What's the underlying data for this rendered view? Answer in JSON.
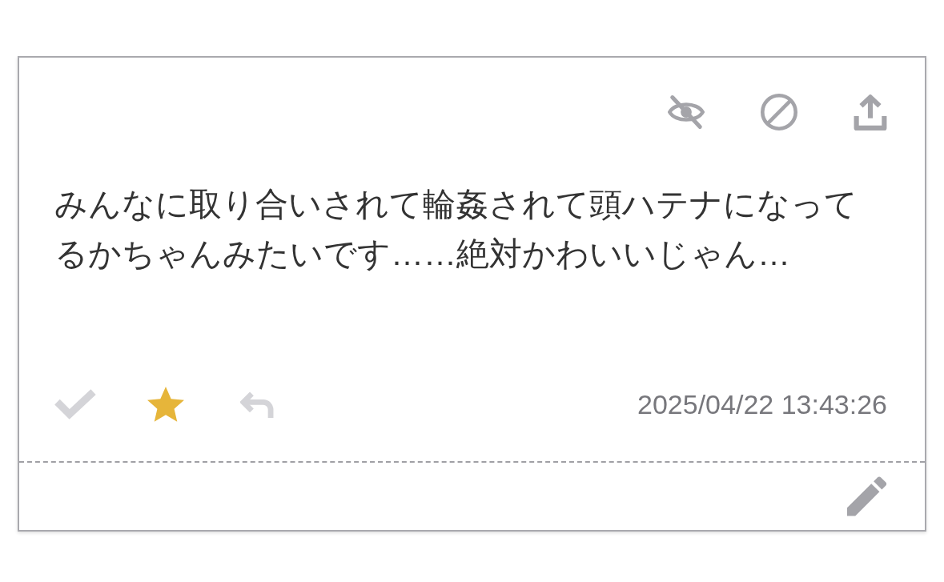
{
  "message": {
    "text": "みんなに取り合いされて輪姦されて頭ハテナになってるかちゃんみたいです……絶対かわいいじゃん…",
    "timestamp": "2025/04/22 13:43:26",
    "checked": false,
    "starred": true,
    "replied": false
  }
}
